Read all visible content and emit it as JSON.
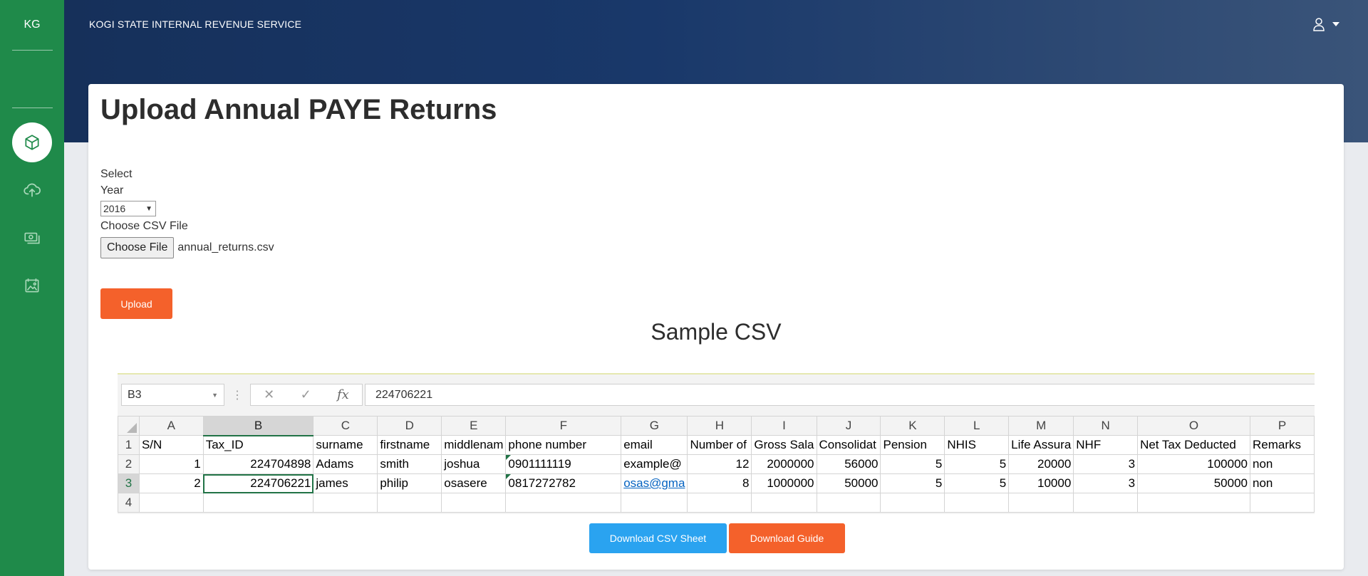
{
  "sidebar": {
    "logo": "KG",
    "items": [
      {
        "icon": "cube-icon",
        "active": true
      },
      {
        "icon": "cloud-upload-icon",
        "active": false
      },
      {
        "icon": "money-icon",
        "active": false
      },
      {
        "icon": "image-gallery-icon",
        "active": false
      }
    ]
  },
  "header": {
    "title": "KOGI STATE INTERNAL REVENUE SERVICE",
    "user_icon": "user-icon"
  },
  "page": {
    "title": "Upload Annual PAYE Returns"
  },
  "form": {
    "select_label_1": "Select",
    "select_label_2": "Year",
    "year_value": "2016",
    "file_label": "Choose CSV File",
    "file_button": "Choose File",
    "file_name": "annual_returns.csv",
    "upload_button": "Upload"
  },
  "sample": {
    "title": "Sample CSV",
    "name_box": "B3",
    "formula_value": "224706221",
    "column_letters": [
      "A",
      "B",
      "C",
      "D",
      "E",
      "F",
      "G",
      "H",
      "I",
      "J",
      "K",
      "L",
      "M",
      "N",
      "O",
      "P"
    ],
    "row_numbers": [
      "1",
      "2",
      "3",
      "4"
    ],
    "headers": [
      "S/N",
      "Tax_ID",
      "surname",
      "firstname",
      "middlenam",
      "phone number",
      "email",
      "Number of",
      "Gross  Sala",
      "Consolidat",
      "Pension",
      "NHIS",
      "Life Assura",
      "NHF",
      "Net Tax Deducted",
      "Remarks"
    ],
    "rows": [
      [
        "1",
        "224704898",
        "Adams",
        "smith",
        "joshua",
        "0901111119",
        "example@",
        "12",
        "2000000",
        "56000",
        "5",
        "5",
        "20000",
        "3",
        "100000",
        "non"
      ],
      [
        "2",
        "224706221",
        "james",
        "philip",
        "osasere",
        "0817272782",
        "osas@gma",
        "8",
        "1000000",
        "50000",
        "5",
        "5",
        "10000",
        "3",
        "50000",
        "non"
      ]
    ]
  },
  "buttons": {
    "download_csv": "Download CSV Sheet",
    "download_guide": "Download Guide"
  },
  "colors": {
    "sidebar": "#1f8a4a",
    "header": "#19386a",
    "accent_orange": "#f4612b",
    "accent_blue": "#2aa3f0"
  }
}
